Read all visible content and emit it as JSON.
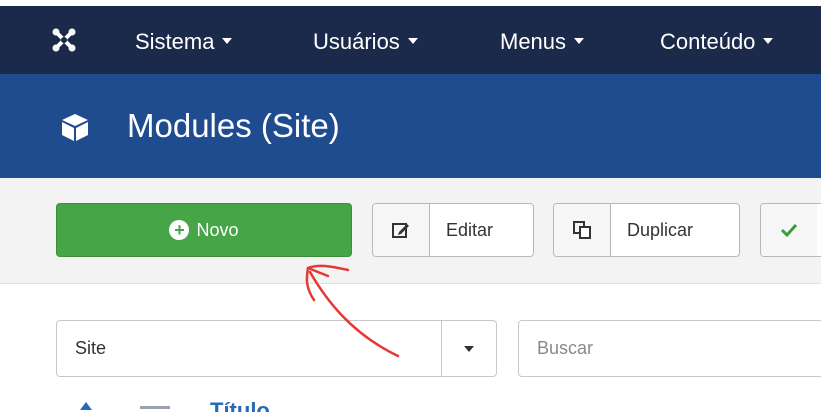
{
  "nav": {
    "items": [
      {
        "label": "Sistema"
      },
      {
        "label": "Usuários"
      },
      {
        "label": "Menus"
      },
      {
        "label": "Conteúdo"
      }
    ]
  },
  "header": {
    "title": "Modules (Site)"
  },
  "toolbar": {
    "new_label": "Novo",
    "edit_label": "Editar",
    "duplicate_label": "Duplicar"
  },
  "filters": {
    "client_selected": "Site",
    "search_placeholder": "Buscar"
  },
  "table": {
    "partial_column_label": "Título"
  },
  "colors": {
    "topbar": "#1b2a4a",
    "titlebar": "#1f4b8f",
    "new_button": "#46a546",
    "annotation": "#e53935"
  }
}
